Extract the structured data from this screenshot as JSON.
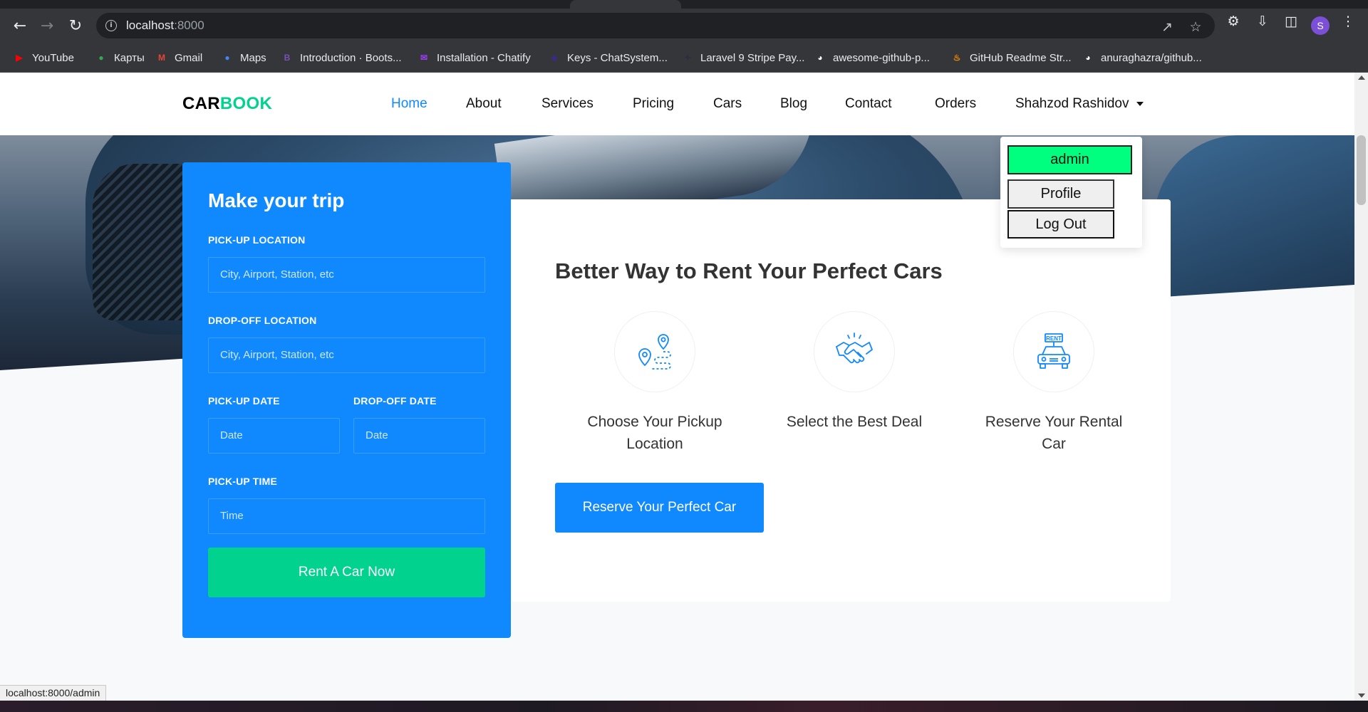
{
  "browser": {
    "url_host": "localhost",
    "url_port": ":8000",
    "avatar_letter": "S",
    "bookmarks": [
      {
        "label": "YouTube",
        "icon": "youtube-icon",
        "color": "#ff0000"
      },
      {
        "label": "Карты",
        "icon": "maps-pin-icon",
        "color": "#34a853"
      },
      {
        "label": "Gmail",
        "icon": "gmail-icon",
        "color": "#ea4335"
      },
      {
        "label": "Maps",
        "icon": "maps-pin-icon",
        "color": "#4285f4"
      },
      {
        "label": "Introduction · Boots...",
        "icon": "bootstrap-icon",
        "color": "#7952b3"
      },
      {
        "label": "Installation - Chatify",
        "icon": "chatify-icon",
        "color": "#9b3df5"
      },
      {
        "label": "Keys - ChatSystem...",
        "icon": "chatsystem-icon",
        "color": "#3a2a80"
      },
      {
        "label": "Laravel 9 Stripe Pay...",
        "icon": "laravel-icon",
        "color": "#2b2d42"
      },
      {
        "label": "awesome-github-p...",
        "icon": "github-icon",
        "color": "#ffffff"
      },
      {
        "label": "GitHub Readme Str...",
        "icon": "fire-icon",
        "color": "#ff8c00"
      },
      {
        "label": "anuraghazra/github...",
        "icon": "github-icon",
        "color": "#ffffff"
      }
    ],
    "status_url": "localhost:8000/admin"
  },
  "site": {
    "brand_part1": "CAR",
    "brand_part2": "BOOK",
    "brand_accent_color": "#01d28e",
    "nav": [
      {
        "label": "Home",
        "active": true
      },
      {
        "label": "About"
      },
      {
        "label": "Services"
      },
      {
        "label": "Pricing"
      },
      {
        "label": "Cars"
      },
      {
        "label": "Blog"
      },
      {
        "label": "Contact"
      },
      {
        "label": "Orders"
      }
    ],
    "user_menu_label": "Shahzod Rashidov",
    "dropdown": {
      "admin": "admin",
      "profile": "Profile",
      "logout": "Log Out"
    }
  },
  "trip_form": {
    "title": "Make your trip",
    "pickup_location_label": "PICK-UP LOCATION",
    "pickup_location_placeholder": "City, Airport, Station, etc",
    "dropoff_location_label": "DROP-OFF LOCATION",
    "dropoff_location_placeholder": "City, Airport, Station, etc",
    "pickup_date_label": "PICK-UP DATE",
    "pickup_date_placeholder": "Date",
    "dropoff_date_label": "DROP-OFF DATE",
    "dropoff_date_placeholder": "Date",
    "pickup_time_label": "PICK-UP TIME",
    "pickup_time_placeholder": "Time",
    "submit_label": "Rent A Car Now",
    "primary_color": "#1089ff"
  },
  "services": {
    "heading": "Better Way to Rent Your Perfect Cars",
    "items": [
      {
        "title": "Choose Your Pickup Location",
        "icon": "route-pin-icon"
      },
      {
        "title": "Select the Best Deal",
        "icon": "handshake-icon"
      },
      {
        "title": "Reserve Your Rental Car",
        "icon": "rent-car-icon"
      }
    ],
    "cta_label": "Reserve Your Perfect Car"
  }
}
